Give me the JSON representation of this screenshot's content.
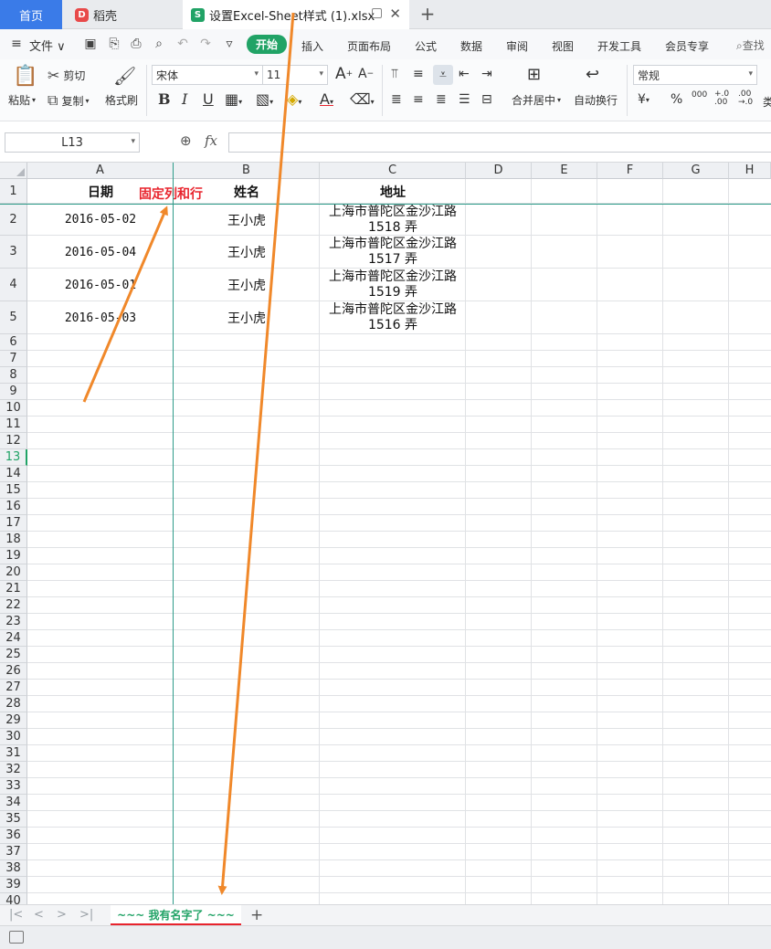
{
  "tabs": {
    "home": "首页",
    "daoke": "稻壳",
    "daoke_logo": "D",
    "file": "设置Excel-Sheet样式 (1).xlsx",
    "file_logo": "S",
    "close_glyph": "✕",
    "add_glyph": "+"
  },
  "menu": {
    "file": "文件 ∨",
    "items": [
      "开始",
      "插入",
      "页面布局",
      "公式",
      "数据",
      "审阅",
      "视图",
      "开发工具",
      "会员专享"
    ],
    "search": "查找"
  },
  "ribbon": {
    "paste": "粘贴",
    "cut": "剪切",
    "copy": "复制",
    "format_painter": "格式刷",
    "font_name": "宋体",
    "font_size": "11",
    "merge_center": "合并居中",
    "wrap_text": "自动换行",
    "number_format": "常规",
    "bold": "B",
    "italic": "I",
    "underline": "U",
    "font_color_letter": "A",
    "grow_font": "A",
    "shrink_font": "A",
    "currency": "¥",
    "percent": "%",
    "thousands": "000",
    "inc_decimal": "+.0\n.00",
    "dec_decimal": ".00\n→.0",
    "more_label": "类"
  },
  "formula_bar": {
    "name_box": "L13",
    "fx": "fx",
    "formula": ""
  },
  "grid": {
    "columns": [
      "A",
      "B",
      "C",
      "D",
      "E",
      "F",
      "G",
      "H"
    ],
    "rows": [
      "1",
      "2",
      "3",
      "4",
      "5",
      "6",
      "7",
      "8",
      "9",
      "10",
      "11",
      "12",
      "13",
      "14",
      "15",
      "16",
      "17",
      "18",
      "19",
      "20",
      "21",
      "22",
      "23",
      "24",
      "25",
      "26",
      "27",
      "28",
      "29",
      "30",
      "31",
      "32",
      "33",
      "34",
      "35",
      "36",
      "37",
      "38",
      "39",
      "40"
    ],
    "selected_row": "13",
    "headers": {
      "date": "日期",
      "name": "姓名",
      "address": "地址"
    },
    "note": "固定列和行",
    "data": [
      {
        "date": "2016-05-02",
        "name": "王小虎",
        "addr1": "上海市普陀区金沙江路",
        "addr2": "1518 弄"
      },
      {
        "date": "2016-05-04",
        "name": "王小虎",
        "addr1": "上海市普陀区金沙江路",
        "addr2": "1517 弄"
      },
      {
        "date": "2016-05-01",
        "name": "王小虎",
        "addr1": "上海市普陀区金沙江路",
        "addr2": "1519 弄"
      },
      {
        "date": "2016-05-03",
        "name": "王小虎",
        "addr1": "上海市普陀区金沙江路",
        "addr2": "1516 弄"
      }
    ]
  },
  "sheets": {
    "nav": [
      "|<",
      "<",
      ">",
      ">|"
    ],
    "active": "~~~ 我有名字了 ~~~",
    "add": "+"
  },
  "colors": {
    "accent": "#21a366",
    "home_tab": "#3a7be8",
    "note_red": "#e8242d",
    "freeze_line": "#2e9c8a",
    "arrow": "#f0882a"
  }
}
